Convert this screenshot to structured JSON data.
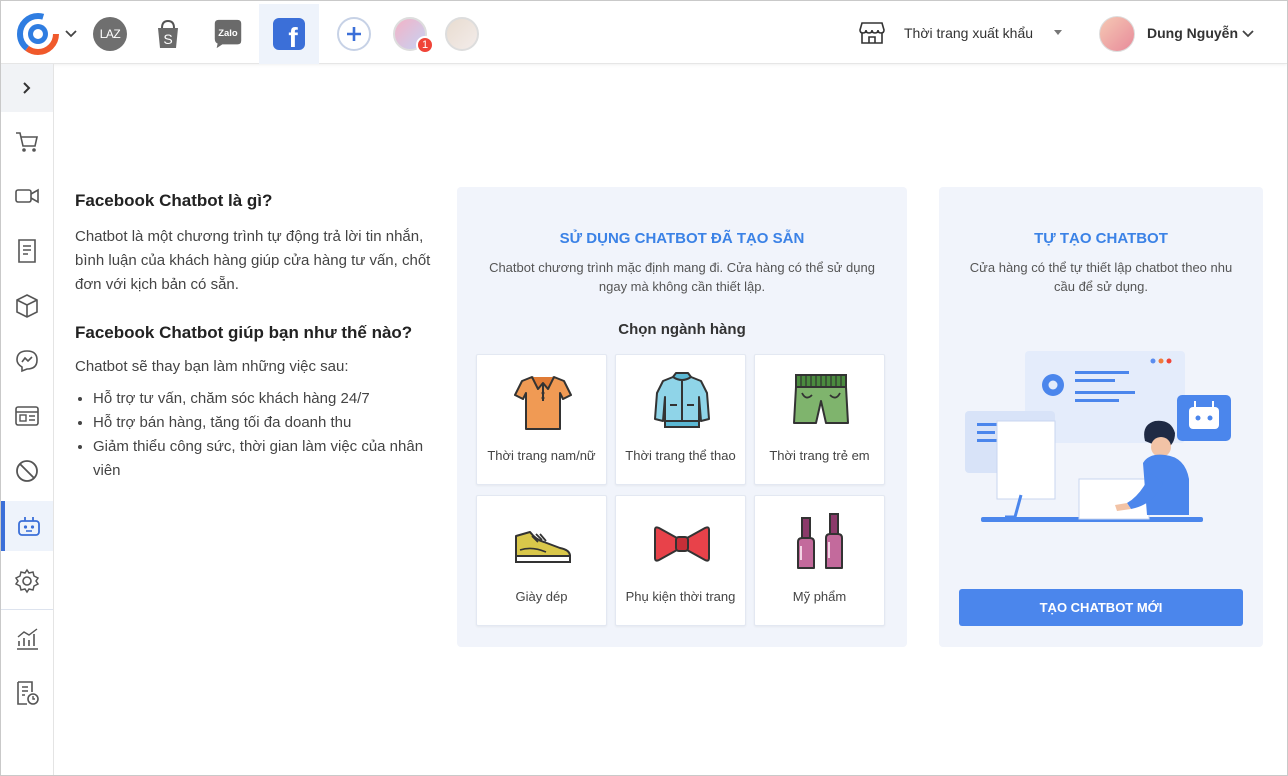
{
  "topbar": {
    "channels": [
      {
        "name": "lazada",
        "label": "LAZ"
      },
      {
        "name": "shopee",
        "label": "S"
      },
      {
        "name": "zalo",
        "label": "Zalo"
      },
      {
        "name": "facebook",
        "label": "f"
      }
    ],
    "notification_count": "1",
    "store_name": "Thời trang xuất khẩu",
    "user_name": "Dung Nguyễn"
  },
  "sidebar": {
    "items": [
      {
        "icon": "cart-icon"
      },
      {
        "icon": "video-icon"
      },
      {
        "icon": "document-icon"
      },
      {
        "icon": "box-icon"
      },
      {
        "icon": "messenger-icon"
      },
      {
        "icon": "id-card-icon"
      },
      {
        "icon": "block-icon"
      },
      {
        "icon": "chatbot-icon",
        "active": true
      },
      {
        "icon": "gear-icon"
      },
      {
        "icon": "chart-icon"
      },
      {
        "icon": "report-clock-icon"
      }
    ]
  },
  "intro": {
    "title1": "Facebook Chatbot là gì?",
    "para1": "Chatbot là một chương trình tự động trả lời tin nhắn, bình luận của khách hàng giúp cửa hàng tư vấn, chốt đơn với kịch bản có sẵn.",
    "title2": "Facebook Chatbot giúp bạn như thế nào?",
    "para2": "Chatbot sẽ thay bạn làm những việc sau:",
    "bullets": [
      "Hỗ trợ tư vấn, chăm sóc khách hàng 24/7",
      "Hỗ trợ bán hàng, tăng tối đa doanh thu",
      "Giảm thiểu công sức, thời gian làm việc của nhân viên"
    ]
  },
  "prebuilt": {
    "title": "SỬ DỤNG CHATBOT ĐÃ TẠO SẴN",
    "desc": "Chatbot chương trình mặc định mang đi. Cửa hàng có thể sử dụng ngay mà không cần thiết lập.",
    "choose_label": "Chọn ngành hàng",
    "categories": [
      {
        "label": "Thời trang nam/nữ",
        "icon": "polo-shirt-icon"
      },
      {
        "label": "Thời trang thể thao",
        "icon": "jacket-icon"
      },
      {
        "label": "Thời trang trẻ em",
        "icon": "shorts-icon"
      },
      {
        "label": "Giày dép",
        "icon": "sneaker-icon"
      },
      {
        "label": "Phụ kiện thời trang",
        "icon": "bow-tie-icon"
      },
      {
        "label": "Mỹ phẩm",
        "icon": "nail-polish-icon"
      }
    ]
  },
  "create": {
    "title": "TỰ TẠO CHATBOT",
    "desc": "Cửa hàng có thể tự thiết lập chatbot theo nhu cầu để sử dụng.",
    "button": "TẠO CHATBOT MỚI"
  },
  "colors": {
    "accent": "#3b82e6",
    "button": "#4b86ec",
    "panel_bg": "#f1f4fb",
    "badge": "#f04438"
  }
}
